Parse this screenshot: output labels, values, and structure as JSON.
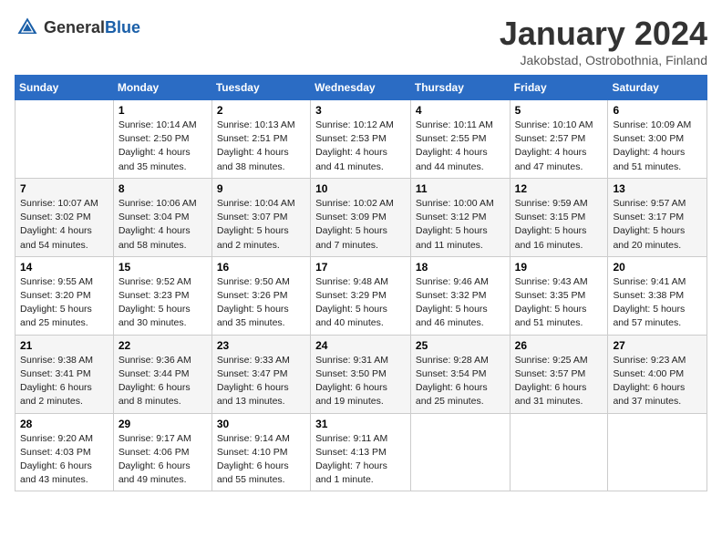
{
  "header": {
    "logo_general": "General",
    "logo_blue": "Blue",
    "month": "January 2024",
    "location": "Jakobstad, Ostrobothnia, Finland"
  },
  "weekdays": [
    "Sunday",
    "Monday",
    "Tuesday",
    "Wednesday",
    "Thursday",
    "Friday",
    "Saturday"
  ],
  "weeks": [
    [
      {
        "day": "",
        "info": ""
      },
      {
        "day": "1",
        "info": "Sunrise: 10:14 AM\nSunset: 2:50 PM\nDaylight: 4 hours\nand 35 minutes."
      },
      {
        "day": "2",
        "info": "Sunrise: 10:13 AM\nSunset: 2:51 PM\nDaylight: 4 hours\nand 38 minutes."
      },
      {
        "day": "3",
        "info": "Sunrise: 10:12 AM\nSunset: 2:53 PM\nDaylight: 4 hours\nand 41 minutes."
      },
      {
        "day": "4",
        "info": "Sunrise: 10:11 AM\nSunset: 2:55 PM\nDaylight: 4 hours\nand 44 minutes."
      },
      {
        "day": "5",
        "info": "Sunrise: 10:10 AM\nSunset: 2:57 PM\nDaylight: 4 hours\nand 47 minutes."
      },
      {
        "day": "6",
        "info": "Sunrise: 10:09 AM\nSunset: 3:00 PM\nDaylight: 4 hours\nand 51 minutes."
      }
    ],
    [
      {
        "day": "7",
        "info": "Sunrise: 10:07 AM\nSunset: 3:02 PM\nDaylight: 4 hours\nand 54 minutes."
      },
      {
        "day": "8",
        "info": "Sunrise: 10:06 AM\nSunset: 3:04 PM\nDaylight: 4 hours\nand 58 minutes."
      },
      {
        "day": "9",
        "info": "Sunrise: 10:04 AM\nSunset: 3:07 PM\nDaylight: 5 hours\nand 2 minutes."
      },
      {
        "day": "10",
        "info": "Sunrise: 10:02 AM\nSunset: 3:09 PM\nDaylight: 5 hours\nand 7 minutes."
      },
      {
        "day": "11",
        "info": "Sunrise: 10:00 AM\nSunset: 3:12 PM\nDaylight: 5 hours\nand 11 minutes."
      },
      {
        "day": "12",
        "info": "Sunrise: 9:59 AM\nSunset: 3:15 PM\nDaylight: 5 hours\nand 16 minutes."
      },
      {
        "day": "13",
        "info": "Sunrise: 9:57 AM\nSunset: 3:17 PM\nDaylight: 5 hours\nand 20 minutes."
      }
    ],
    [
      {
        "day": "14",
        "info": "Sunrise: 9:55 AM\nSunset: 3:20 PM\nDaylight: 5 hours\nand 25 minutes."
      },
      {
        "day": "15",
        "info": "Sunrise: 9:52 AM\nSunset: 3:23 PM\nDaylight: 5 hours\nand 30 minutes."
      },
      {
        "day": "16",
        "info": "Sunrise: 9:50 AM\nSunset: 3:26 PM\nDaylight: 5 hours\nand 35 minutes."
      },
      {
        "day": "17",
        "info": "Sunrise: 9:48 AM\nSunset: 3:29 PM\nDaylight: 5 hours\nand 40 minutes."
      },
      {
        "day": "18",
        "info": "Sunrise: 9:46 AM\nSunset: 3:32 PM\nDaylight: 5 hours\nand 46 minutes."
      },
      {
        "day": "19",
        "info": "Sunrise: 9:43 AM\nSunset: 3:35 PM\nDaylight: 5 hours\nand 51 minutes."
      },
      {
        "day": "20",
        "info": "Sunrise: 9:41 AM\nSunset: 3:38 PM\nDaylight: 5 hours\nand 57 minutes."
      }
    ],
    [
      {
        "day": "21",
        "info": "Sunrise: 9:38 AM\nSunset: 3:41 PM\nDaylight: 6 hours\nand 2 minutes."
      },
      {
        "day": "22",
        "info": "Sunrise: 9:36 AM\nSunset: 3:44 PM\nDaylight: 6 hours\nand 8 minutes."
      },
      {
        "day": "23",
        "info": "Sunrise: 9:33 AM\nSunset: 3:47 PM\nDaylight: 6 hours\nand 13 minutes."
      },
      {
        "day": "24",
        "info": "Sunrise: 9:31 AM\nSunset: 3:50 PM\nDaylight: 6 hours\nand 19 minutes."
      },
      {
        "day": "25",
        "info": "Sunrise: 9:28 AM\nSunset: 3:54 PM\nDaylight: 6 hours\nand 25 minutes."
      },
      {
        "day": "26",
        "info": "Sunrise: 9:25 AM\nSunset: 3:57 PM\nDaylight: 6 hours\nand 31 minutes."
      },
      {
        "day": "27",
        "info": "Sunrise: 9:23 AM\nSunset: 4:00 PM\nDaylight: 6 hours\nand 37 minutes."
      }
    ],
    [
      {
        "day": "28",
        "info": "Sunrise: 9:20 AM\nSunset: 4:03 PM\nDaylight: 6 hours\nand 43 minutes."
      },
      {
        "day": "29",
        "info": "Sunrise: 9:17 AM\nSunset: 4:06 PM\nDaylight: 6 hours\nand 49 minutes."
      },
      {
        "day": "30",
        "info": "Sunrise: 9:14 AM\nSunset: 4:10 PM\nDaylight: 6 hours\nand 55 minutes."
      },
      {
        "day": "31",
        "info": "Sunrise: 9:11 AM\nSunset: 4:13 PM\nDaylight: 7 hours\nand 1 minute."
      },
      {
        "day": "",
        "info": ""
      },
      {
        "day": "",
        "info": ""
      },
      {
        "day": "",
        "info": ""
      }
    ]
  ]
}
